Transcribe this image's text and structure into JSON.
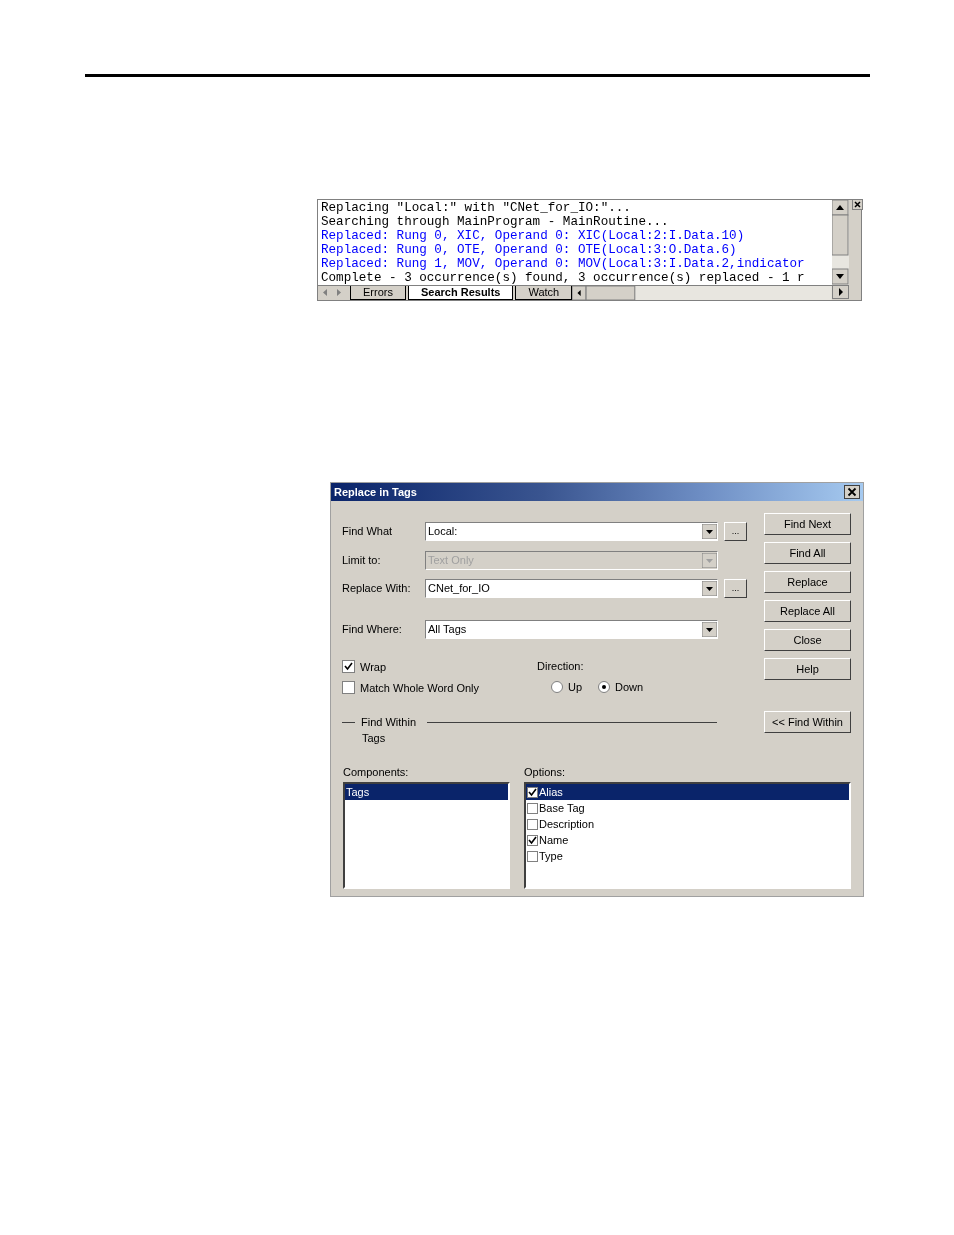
{
  "output_window": {
    "lines": [
      {
        "text": "Replacing \"Local:\" with \"CNet_for_IO:\"...",
        "kind": "info"
      },
      {
        "text": "Searching through MainProgram - MainRoutine...",
        "kind": "info"
      },
      {
        "text": "Replaced: Rung 0, XIC, Operand 0: XIC(Local:2:I.Data.10)",
        "kind": "replaced"
      },
      {
        "text": "Replaced: Rung 0, OTE, Operand 0: OTE(Local:3:O.Data.6)",
        "kind": "replaced"
      },
      {
        "text": "Replaced: Rung 1, MOV, Operand 0: MOV(Local:3:I.Data.2,indicator",
        "kind": "replaced"
      },
      {
        "text": "Complete - 3 occurrence(s) found, 3 occurrence(s) replaced - 1 r",
        "kind": "info"
      }
    ],
    "tabs": [
      {
        "label": "Errors",
        "selected": false
      },
      {
        "label": "Search Results",
        "selected": true
      },
      {
        "label": "Watch",
        "selected": false
      }
    ]
  },
  "dialog": {
    "title": "Replace in Tags",
    "fields": [
      {
        "label": "Find What",
        "value": "Local:",
        "disabled": false,
        "browse": "..."
      },
      {
        "label": "Limit to:",
        "value": "Text Only",
        "disabled": true
      },
      {
        "label": "Replace With:",
        "value": "CNet_for_IO",
        "disabled": false,
        "browse": "..."
      },
      {
        "label": "Find Where:",
        "value": "All Tags",
        "disabled": false
      }
    ],
    "checkboxes": [
      {
        "label": "Wrap",
        "checked": true
      },
      {
        "label": "Match Whole Word Only",
        "checked": false
      }
    ],
    "direction": {
      "label": "Direction:",
      "options": [
        {
          "label": "Up",
          "selected": false
        },
        {
          "label": "Down",
          "selected": true
        }
      ]
    },
    "find_within": {
      "label": "Find Within",
      "value": "Tags"
    },
    "buttons": [
      "Find Next",
      "Find All",
      "Replace",
      "Replace All",
      "Close",
      "Help"
    ],
    "find_within_button": "<< Find Within",
    "components": {
      "label": "Components:",
      "items": [
        {
          "label": "Tags",
          "selected": true
        }
      ]
    },
    "options": {
      "label": "Options:",
      "items": [
        {
          "label": "Alias",
          "checked": true,
          "selected": true
        },
        {
          "label": "Base Tag",
          "checked": false,
          "selected": false
        },
        {
          "label": "Description",
          "checked": false,
          "selected": false
        },
        {
          "label": "Name",
          "checked": true,
          "selected": false
        },
        {
          "label": "Type",
          "checked": false,
          "selected": false
        }
      ]
    }
  }
}
